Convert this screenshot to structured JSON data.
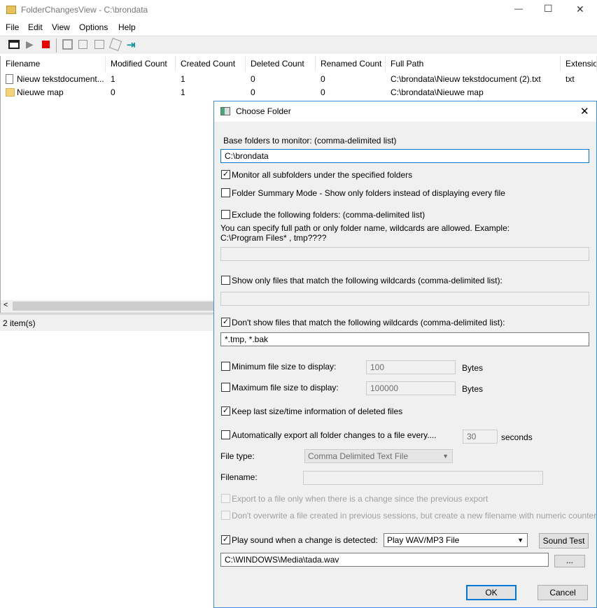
{
  "window": {
    "title": "FolderChangesView  -  C:\\brondata",
    "minimize": "—",
    "maximize": "☐",
    "close": "✕"
  },
  "menu": [
    "File",
    "Edit",
    "View",
    "Options",
    "Help"
  ],
  "toolbar": [
    "properties-icon",
    "play-icon",
    "stop-icon",
    "save-icon",
    "copy-icon",
    "html-report-icon",
    "find-icon",
    "exit-icon"
  ],
  "list": {
    "columns": [
      "Filename",
      "Modified Count",
      "Created Count",
      "Deleted Count",
      "Renamed Count",
      "Full Path",
      "Extension"
    ],
    "rows": [
      [
        "Nieuw tekstdocument...",
        "1",
        "1",
        "0",
        "0",
        "C:\\brondata\\Nieuw tekstdocument (2).txt",
        "txt"
      ],
      [
        "Nieuwe map",
        "0",
        "1",
        "0",
        "0",
        "C:\\brondata\\Nieuwe map",
        ""
      ]
    ]
  },
  "status": "2 item(s)",
  "dialog": {
    "title": "Choose Folder",
    "close": "✕",
    "base_label": "Base folders to monitor:  (comma-delimited list)",
    "base_value": "C:\\brondata",
    "monitor_sub": "Monitor all subfolders under the specified folders",
    "summary_mode": "Folder Summary Mode - Show only folders instead of displaying every file",
    "exclude": "Exclude the following folders: (comma-delimited list)",
    "exclude_hint1": "You can specify full path or only folder name, wildcards are allowed. Example:",
    "exclude_hint2": "C:\\Program Files* , tmp????",
    "exclude_value": "",
    "show_only": "Show only files that match the following wildcards (comma-delimited list):",
    "show_only_value": "",
    "dont_show": "Don't show files that match the following wildcards (comma-delimited list):",
    "dont_show_value": "*.tmp, *.bak",
    "min_size": "Minimum file size to display:",
    "min_value": "100",
    "max_size": "Maximum file size to display:",
    "max_value": "100000",
    "bytes": "Bytes",
    "keep_last": "Keep last size/time information of deleted files",
    "auto_export": "Automatically export all folder changes to a file every....",
    "auto_value": "30",
    "seconds": "seconds",
    "file_type_label": "File type:",
    "file_type_value": "Comma Delimited Text File",
    "filename_label": "Filename:",
    "filename_value": "",
    "export_change": "Export to a file only when there is a change since the previous export",
    "dont_overwrite": "Don't overwrite a file created in previous sessions, but create a new filename with numeric counter",
    "play_sound": "Play sound when a change is detected:",
    "sound_type": "Play WAV/MP3 File",
    "sound_test": "Sound Test",
    "sound_file": "C:\\WINDOWS\\Media\\tada.wav",
    "browse": "...",
    "ok": "OK",
    "cancel": "Cancel"
  }
}
